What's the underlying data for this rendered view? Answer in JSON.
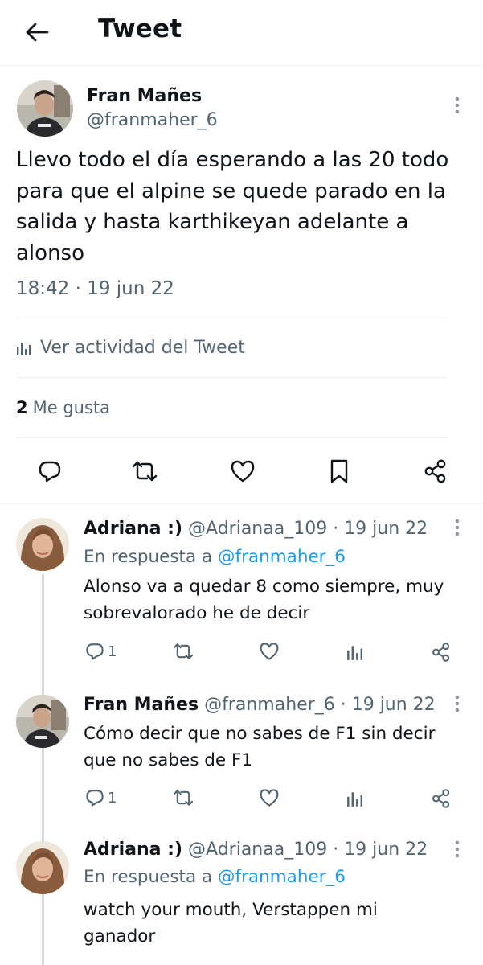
{
  "header": {
    "title": "Tweet",
    "back_icon": "arrow-left-icon"
  },
  "main_tweet": {
    "author_name": "Fran Mañes",
    "author_handle": "@franmaher_6",
    "text": "Llevo todo el día esperando a las 20 todo para que el alpine se quede parado en la salida y hasta karthikeyan adelante a alonso",
    "timestamp": "18:42 · 19 jun 22",
    "activity_label": "Ver actividad del Tweet",
    "likes_count": "2",
    "likes_label": "Me gusta",
    "actions": [
      "reply-icon",
      "retweet-icon",
      "like-icon",
      "bookmark-icon",
      "share-icon"
    ]
  },
  "replies": [
    {
      "name": "Adriana :)",
      "handle": "@Adrianaa_109",
      "date": "· 19 jun 22",
      "reply_to_prefix": "En respuesta a ",
      "reply_to_handle": "@franmaher_6",
      "text": "Alonso va a quedar 8 como siempre, muy sobrevalorado he de decir",
      "reply_count": "1"
    },
    {
      "name": "Fran Mañes",
      "handle": "@franmaher_6",
      "date": "· 19 jun 22",
      "text": "Cómo decir que no sabes de F1 sin decir que no sabes de F1",
      "reply_count": "1"
    },
    {
      "name": "Adriana :)",
      "handle": "@Adrianaa_109",
      "date": "· 19 jun 22",
      "reply_to_prefix": "En respuesta a ",
      "reply_to_handle": "@franmaher_6",
      "text": "watch your mouth, Verstappen mi ganador"
    }
  ],
  "colors": {
    "text": "#0f1419",
    "secondary": "#536471",
    "accent": "#1d9bf0",
    "divider": "#eff3f4",
    "thread_line": "#cfd9de"
  }
}
